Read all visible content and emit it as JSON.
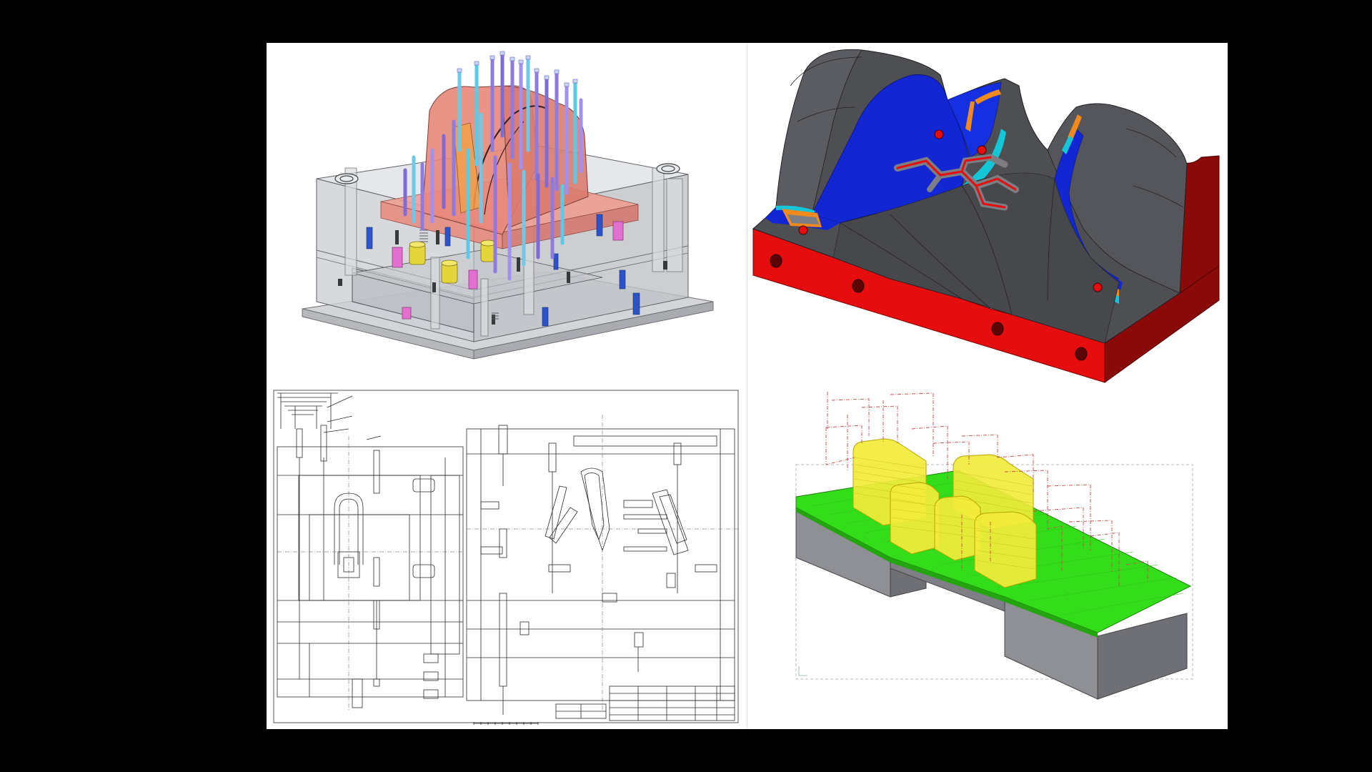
{
  "image": {
    "background": "#000000",
    "canvas_background": "#ffffff"
  },
  "panels": [
    {
      "id": "mold-assembly-3d",
      "icon": "mold-assembly-icon",
      "colors": {
        "core": "#e8877a",
        "pins": "#7f6bd6",
        "plates": "#c9ccd1",
        "bushing": "#e4d63a",
        "spacer": "#e36fd0",
        "bolt": "#2c54c8"
      }
    },
    {
      "id": "cavity-analysis-3d",
      "icon": "cavity-analysis-icon",
      "colors": {
        "base": "#e50d0d",
        "surface": "#4e4f53",
        "steep": "#1226d4",
        "band_cyan": "#13c6d8",
        "band_orange": "#f08a1c"
      }
    },
    {
      "id": "mold-2d-drawing",
      "icon": "technical-drawing-icon",
      "colors": {
        "line": "#2b2b2b"
      }
    },
    {
      "id": "cnc-toolpath",
      "icon": "toolpath-icon",
      "colors": {
        "floor": "#33dd1a",
        "bosses": "#f2ea3a",
        "base": "#8f9095",
        "rapid": "#c44a4a"
      }
    }
  ]
}
